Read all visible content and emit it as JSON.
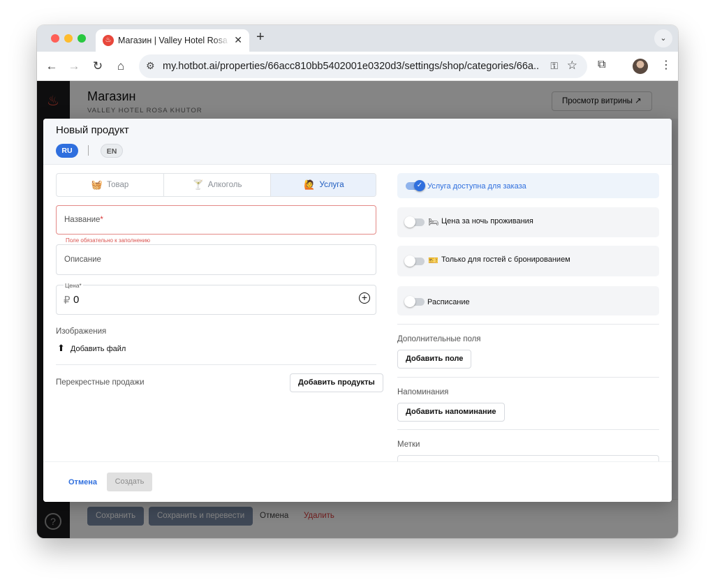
{
  "browser": {
    "tab_title": "Магазин | Valley Hotel Rosa Khutor",
    "url": "my.hotbot.ai/properties/66acc810bb5402001e0320d3/settings/shop/categories/66a..."
  },
  "app": {
    "title": "Магазин",
    "subtitle": "VALLEY HOTEL ROSA KHUTOR",
    "preview_button": "Просмотр витрины ↗",
    "footer": {
      "save": "Сохранить",
      "save_translate": "Сохранить и перевести",
      "cancel": "Отмена",
      "delete": "Удалить"
    }
  },
  "modal": {
    "title": "Новый продукт",
    "languages": [
      "RU",
      "EN"
    ],
    "active_language": "RU",
    "product_types": [
      {
        "label": "Товар",
        "icon": "basket-icon"
      },
      {
        "label": "Алкоголь",
        "icon": "cocktail-glass-icon"
      },
      {
        "label": "Услуга",
        "icon": "service-person-icon",
        "selected": true
      }
    ],
    "name_field": {
      "label": "Название",
      "required_mark": "*",
      "value": "",
      "error": "Поле обязательно к заполнению"
    },
    "description_field": {
      "label": "Описание",
      "value": ""
    },
    "price_field": {
      "label": "Цена*",
      "currency": "₽",
      "value": "0"
    },
    "images": {
      "label": "Изображения",
      "add_file": "Добавить файл"
    },
    "cross_sales": {
      "label": "Перекрестные продажи",
      "button": "Добавить продукты"
    },
    "toggles": [
      {
        "label": "Услуга доступна для заказа",
        "on": true,
        "icon": ""
      },
      {
        "label": "Цена за ночь проживания",
        "on": false,
        "icon": "bed-icon"
      },
      {
        "label": "Только для гостей с бронированием",
        "on": false,
        "icon": "ticket-icon"
      },
      {
        "label": "Расписание",
        "on": false,
        "icon": ""
      }
    ],
    "extra_fields": {
      "label": "Дополнительные поля",
      "button": "Добавить поле"
    },
    "reminders": {
      "label": "Напоминания",
      "button": "Добавить напоминание"
    },
    "tags": {
      "label": "Метки",
      "value": ""
    },
    "footer": {
      "cancel": "Отмена",
      "create": "Создать"
    }
  },
  "colors": {
    "accent": "#2f6fde",
    "error": "#d9534f",
    "delete": "#d93a3a",
    "sidebar": "#1c1c1e"
  }
}
